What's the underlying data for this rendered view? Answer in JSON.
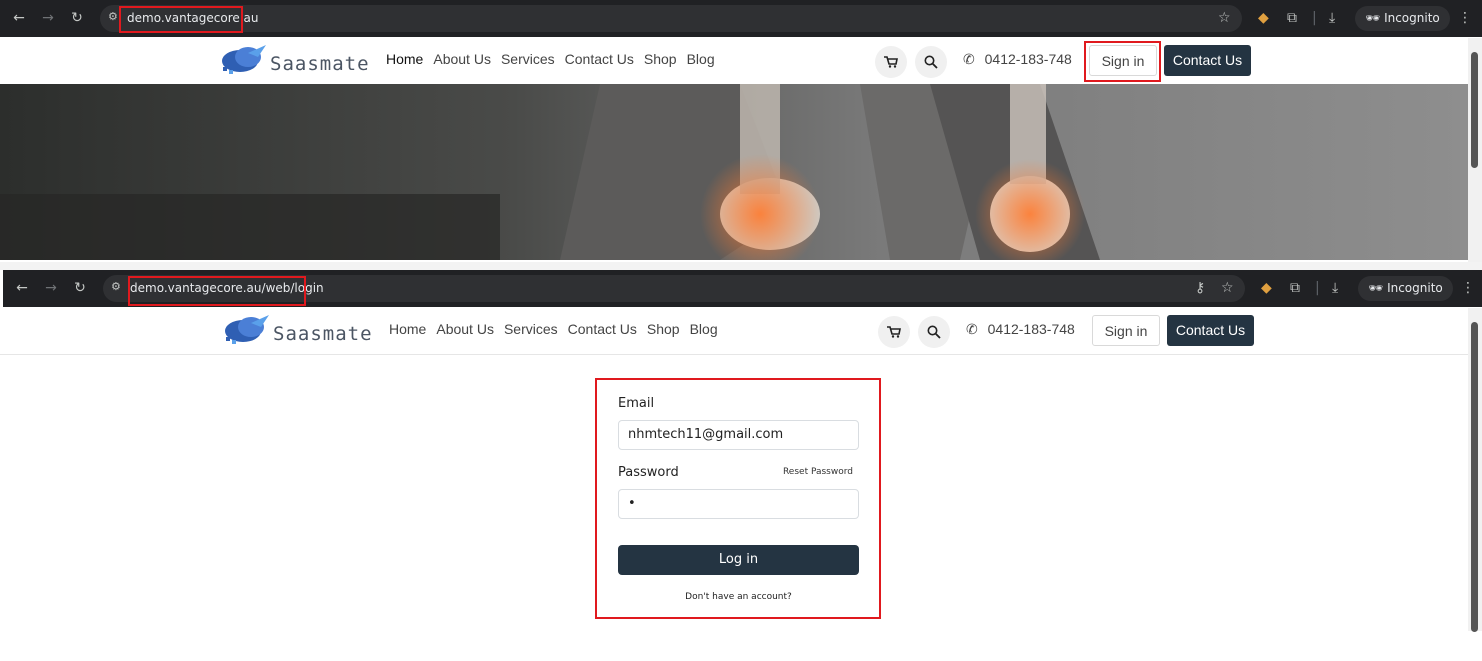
{
  "top_window": {
    "url": "demo.vantagecore.au",
    "incognito_label": "Incognito"
  },
  "bottom_window": {
    "url": "demo.vantagecore.au/web/login",
    "incognito_label": "Incognito"
  },
  "site": {
    "logo_text": "Saasmate",
    "nav": [
      "Home",
      "About Us",
      "Services",
      "Contact Us",
      "Shop",
      "Blog"
    ],
    "phone": "0412-183-748",
    "signin_label": "Sign in",
    "contact_label": "Contact Us"
  },
  "login": {
    "email_label": "Email",
    "email_value": "nhmtech11@gmail.com",
    "password_label": "Password",
    "reset_label": "Reset Password",
    "password_value": "•",
    "login_label": "Log in",
    "signup_label": "Don't have an account?"
  },
  "colors": {
    "chrome_bg": "#202124",
    "primary_button": "#243442",
    "highlight": "#e0191e"
  }
}
